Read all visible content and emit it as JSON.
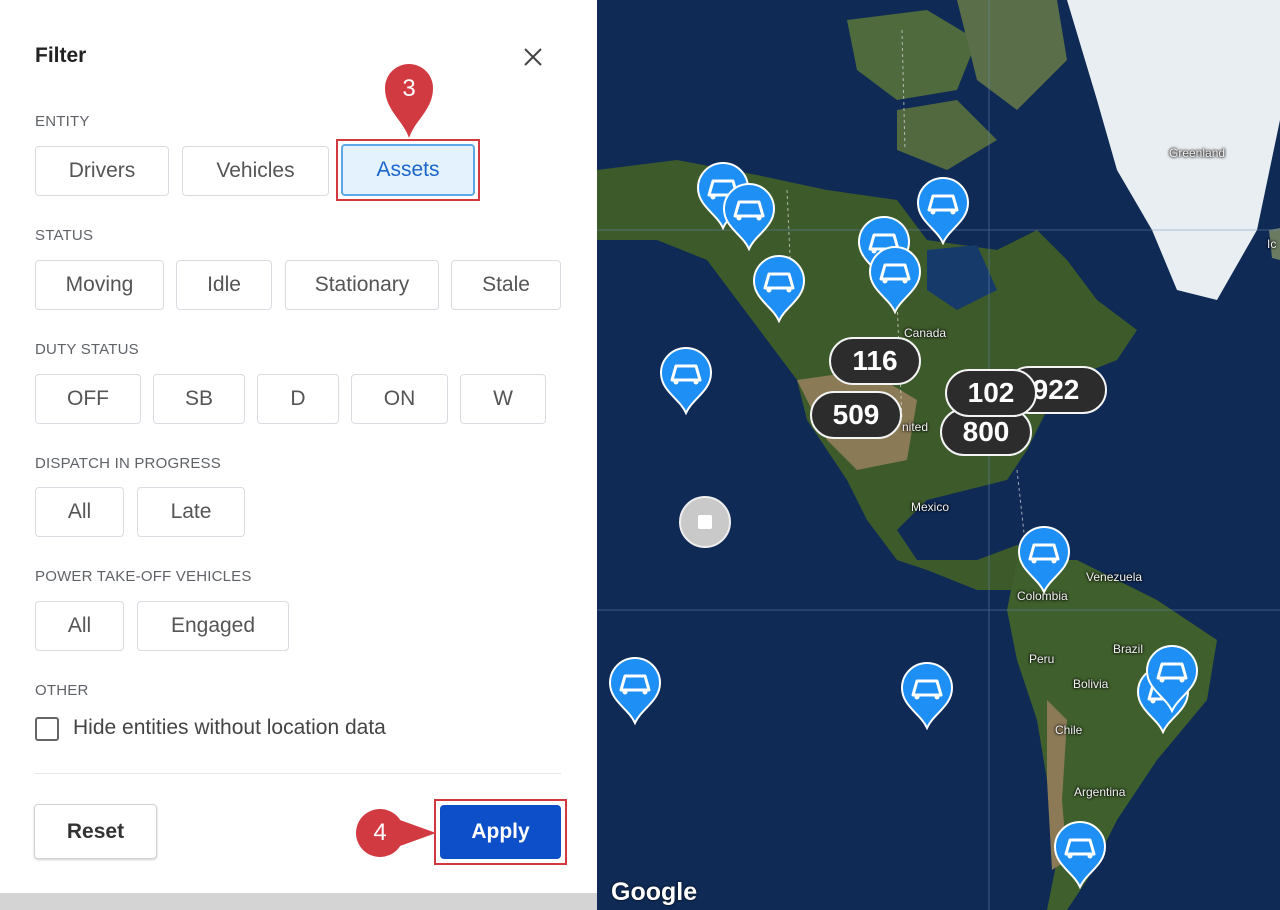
{
  "filter": {
    "title": "Filter",
    "entity": {
      "label": "ENTITY",
      "options": [
        "Drivers",
        "Vehicles",
        "Assets"
      ],
      "selected": "Assets"
    },
    "status": {
      "label": "STATUS",
      "options": [
        "Moving",
        "Idle",
        "Stationary",
        "Stale"
      ]
    },
    "duty_status": {
      "label": "DUTY STATUS",
      "options": [
        "OFF",
        "SB",
        "D",
        "ON",
        "W"
      ]
    },
    "dispatch": {
      "label": "DISPATCH IN PROGRESS",
      "options": [
        "All",
        "Late"
      ]
    },
    "pto": {
      "label": "POWER TAKE-OFF VEHICLES",
      "options": [
        "All",
        "Engaged"
      ]
    },
    "other": {
      "label": "OTHER",
      "hide_entities_label": "Hide entities without location data",
      "checked": false
    },
    "reset_label": "Reset",
    "apply_label": "Apply"
  },
  "annotations": {
    "step3": "3",
    "step4": "4",
    "color": "#d23a41"
  },
  "map": {
    "labels": [
      "Greenland",
      "Ic",
      "Canada",
      "nited",
      "Mexico",
      "Venezuela",
      "Colombia",
      "Brazil",
      "Peru",
      "Bolivia",
      "Chile",
      "Argentina"
    ],
    "clusters": [
      "116",
      "509",
      "102",
      "922",
      "800"
    ],
    "attribution": "Google",
    "marker_icon": "asset-trailer-icon",
    "colors": {
      "pin": "#1e8ff5",
      "cluster": "#2c2c2c",
      "ocean": "#0f2a55",
      "land": "#3d5a2a",
      "ice": "#e9eef2"
    }
  }
}
